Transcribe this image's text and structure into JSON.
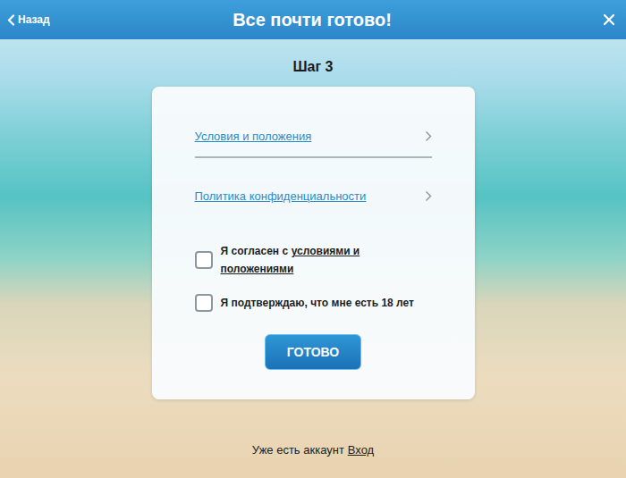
{
  "header": {
    "back": "Назад",
    "title": "Все почти готово!"
  },
  "step": "Шаг 3",
  "links": [
    {
      "label": "Условия и положения"
    },
    {
      "label": "Политика конфиденциальности"
    }
  ],
  "checkboxes": [
    {
      "text": "Я согласен с",
      "link": "условиями и положениями",
      "checked": false
    },
    {
      "text": "Я подтверждаю, что мне есть 18 лет",
      "link": "",
      "checked": false
    }
  ],
  "submit": "ГОТОВО",
  "footer": {
    "text": "Уже есть аккаунт",
    "link": "Вход"
  }
}
